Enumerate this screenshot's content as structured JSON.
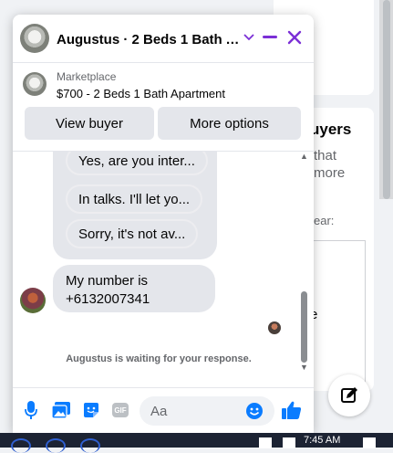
{
  "background": {
    "heading_partial": "uyers",
    "line1": "that",
    "line2": "more",
    "line3": "ear:",
    "line4": "e"
  },
  "chat": {
    "title": "Augustus · 2 Beds 1 Bath A...",
    "listing": {
      "source": "Marketplace",
      "title": "$700 - 2 Beds 1 Bath Apartment",
      "view_buyer_label": "View buyer",
      "more_options_label": "More options"
    },
    "quick_replies": [
      "Yes, are you inter...",
      "In talks. I'll let yo...",
      "Sorry, it's not av..."
    ],
    "incoming_message": {
      "line1": "My number is",
      "line2": "+6132007341"
    },
    "status_text": "Augustus is waiting for your response.",
    "composer": {
      "placeholder": "Aa",
      "gif_label": "GIF"
    }
  },
  "taskbar": {
    "time": "7:45 AM"
  },
  "colors": {
    "accent": "#7b2fd6",
    "messenger_blue": "#0a7cff",
    "bubble_gray": "#e4e6eb",
    "secondary_text": "#65676b"
  },
  "icons": {
    "chevron": "chevron-down-icon",
    "minimize": "minimize-icon",
    "close": "close-icon",
    "mic": "microphone-icon",
    "photo": "photo-icon",
    "sticker": "sticker-icon",
    "gif": "gif-icon",
    "emoji": "emoji-icon",
    "like": "thumbs-up-icon",
    "compose": "compose-icon"
  }
}
